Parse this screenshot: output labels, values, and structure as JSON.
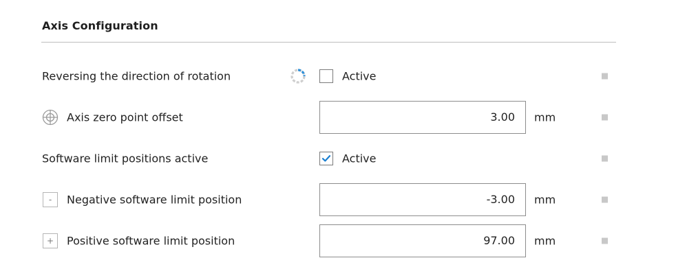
{
  "section": {
    "title": "Axis Configuration"
  },
  "rows": [
    {
      "label": "Reversing the direction of rotation",
      "control": "checkbox",
      "checked": false,
      "checkbox_label": "Active",
      "status_icon": "loading-spinner-icon"
    },
    {
      "label": "Axis zero point offset",
      "control": "number-input",
      "value": "3.00",
      "unit": "mm",
      "lead_icon": "crosshair-icon"
    },
    {
      "label": "Software limit positions active",
      "control": "checkbox",
      "checked": true,
      "checkbox_label": "Active"
    },
    {
      "label": "Negative software limit position",
      "control": "number-input",
      "value": "-3.00",
      "unit": "mm",
      "lead_icon": "minus-box-icon",
      "lead_symbol": "-"
    },
    {
      "label": "Positive software limit position",
      "control": "number-input",
      "value": "97.00",
      "unit": "mm",
      "lead_icon": "plus-box-icon",
      "lead_symbol": "+"
    }
  ],
  "colors": {
    "check_accent": "#1a7fd0",
    "spinner_accent": "#2d8fd8",
    "divider": "#bdbdbd",
    "row_marker": "#c8c8c8"
  }
}
